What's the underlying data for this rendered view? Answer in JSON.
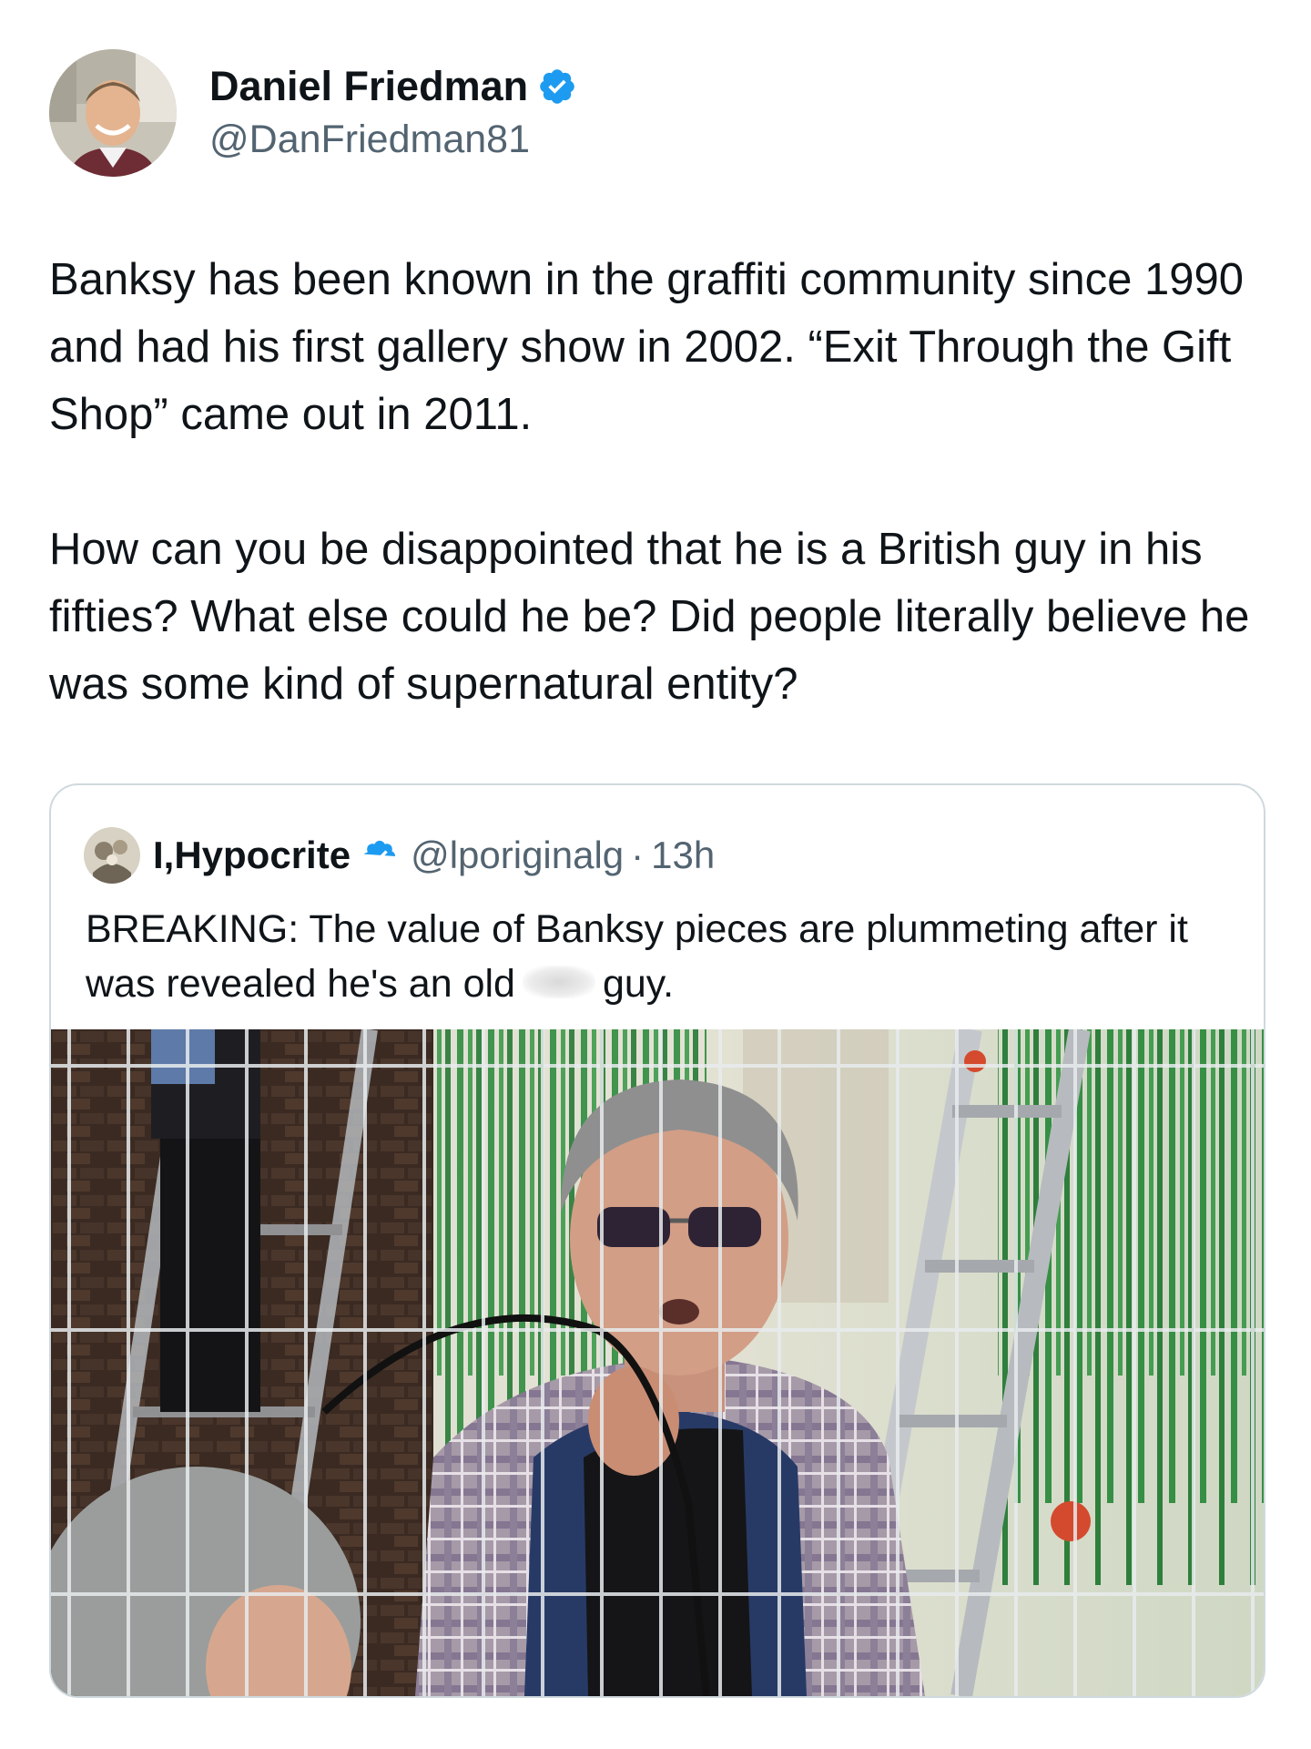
{
  "tweet": {
    "author": {
      "name": "Daniel Friedman",
      "handle": "@DanFriedman81",
      "verified_icon": "verified-badge-icon"
    },
    "paragraphs": [
      "Banksy has been known in the graffiti community since 1990 and had his first gallery show in 2002. “Exit Through the Gift Shop” came out in 2011.",
      "How can you be disappointed that he is a British guy in his fifties? What else could he be? Did people literally believe he was some kind of supernatural entity?"
    ]
  },
  "quote": {
    "author": {
      "name": "I,Hypocrite",
      "handle": "@lporiginalg",
      "separator": "·",
      "time": "13h",
      "verified_icon": "verified-badge-icon"
    },
    "text_before": "BREAKING: The value of Banksy pieces are plummeting after it was revealed he's an old",
    "text_after": "guy."
  },
  "colors": {
    "text_primary": "#0f1419",
    "text_secondary": "#536471",
    "verified_blue": "#1d9bf0",
    "border": "#cfd9de"
  }
}
